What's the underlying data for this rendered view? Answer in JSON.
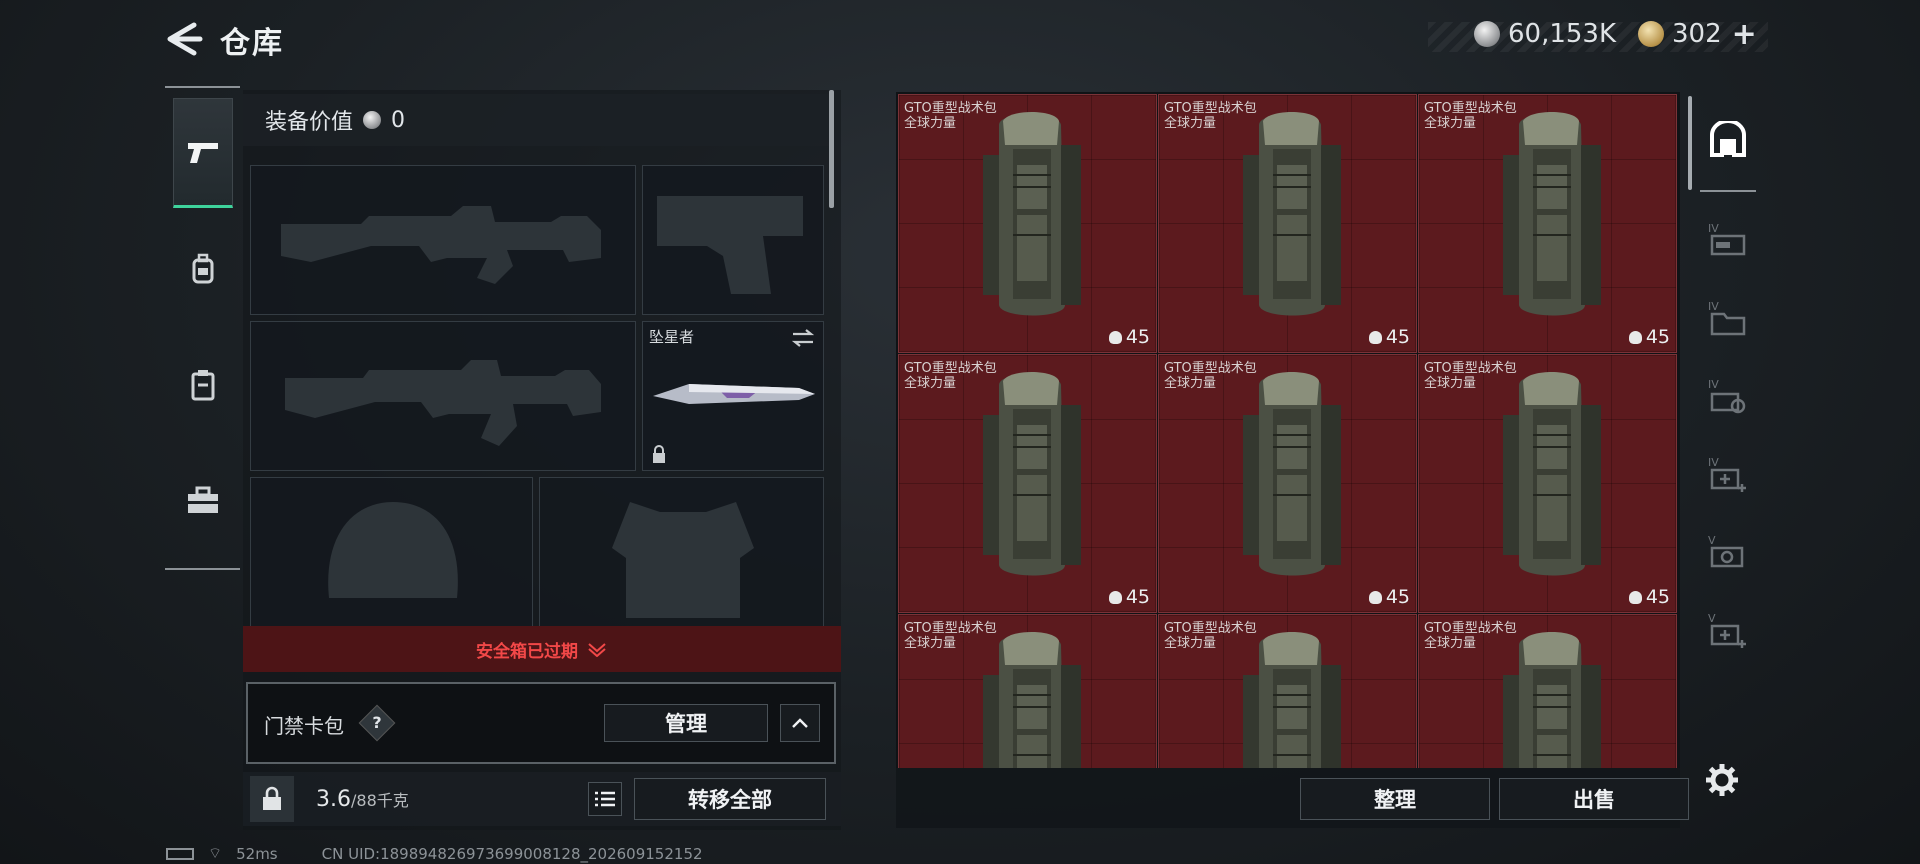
{
  "header": {
    "title": "仓库",
    "silver_amount": "60,153K",
    "gold_amount": "302",
    "gold_plus": "+"
  },
  "sidebar": {
    "tabs": [
      {
        "icon": "pistol-icon",
        "active": true
      },
      {
        "icon": "backpack-icon",
        "active": false
      },
      {
        "icon": "clipboard-icon",
        "active": false
      },
      {
        "icon": "briefcase-icon",
        "active": false
      }
    ]
  },
  "loadout": {
    "equipment_value_label": "装备价值",
    "equipment_value": "0",
    "melee_name": "坠星者",
    "safe_box_text": "安全箱已过期",
    "keycard_label": "门禁卡包",
    "keycard_help": "?",
    "manage_label": "管理",
    "weight_current": "3.6",
    "weight_max": "/88千克",
    "transfer_all_label": "转移全部"
  },
  "stash": {
    "items": [
      {
        "name": "GTO重型战术包",
        "subtitle": "全球力量",
        "count": "45"
      },
      {
        "name": "GTO重型战术包",
        "subtitle": "全球力量",
        "count": "45"
      },
      {
        "name": "GTO重型战术包",
        "subtitle": "全球力量",
        "count": "45"
      },
      {
        "name": "GTO重型战术包",
        "subtitle": "全球力量",
        "count": "45"
      },
      {
        "name": "GTO重型战术包",
        "subtitle": "全球力量",
        "count": "45"
      },
      {
        "name": "GTO重型战术包",
        "subtitle": "全球力量",
        "count": "45"
      },
      {
        "name": "GTO重型战术包",
        "subtitle": "全球力量",
        "count": ""
      },
      {
        "name": "GTO重型战术包",
        "subtitle": "全球力量",
        "count": ""
      },
      {
        "name": "GTO重型战术包",
        "subtitle": "全球力量",
        "count": ""
      }
    ],
    "sort_label": "整理",
    "sell_label": "出售"
  },
  "status": {
    "ping": "52ms",
    "uid": "CN UID:18989482697369900812​8_202609152152"
  },
  "colors": {
    "accent_green": "#3ed39c",
    "stash_red": "#5c1a1e",
    "alert_red": "#f24848"
  }
}
